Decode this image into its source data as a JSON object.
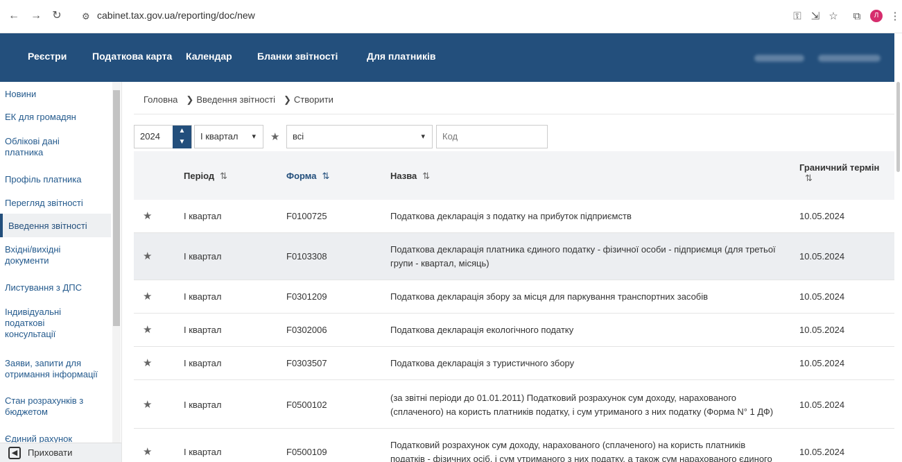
{
  "browser": {
    "url": "cabinet.tax.gov.ua/reporting/doc/new",
    "profile_initial": "Л"
  },
  "topnav": {
    "items": [
      "Реєстри",
      "Податкова карта",
      "Календар",
      "Бланки звітності",
      "Для платників"
    ]
  },
  "sidebar": {
    "items": [
      "Новини",
      "ЕК для громадян",
      "Облікові дані платника",
      "Профіль платника",
      "Перегляд звітності",
      "Введення звітності",
      "Вхідні/вихідні документи",
      "Листування з ДПС",
      "Індивідуальні податкові консультації",
      "Заяви, запити для отримання інформації",
      "Стан розрахунків з бюджетом",
      "Єдиний рахунок"
    ],
    "hide_label": "Приховати"
  },
  "breadcrumb": [
    "Головна",
    "Введення звітності",
    "Створити"
  ],
  "filters": {
    "year": "2024",
    "period": "І квартал",
    "category": "всі",
    "code_placeholder": "Код"
  },
  "table": {
    "headers": {
      "period": "Період",
      "form": "Форма",
      "name": "Назва",
      "deadline_1": "Граничний термін"
    },
    "rows": [
      {
        "period": "І квартал",
        "form": "F0100725",
        "name": "Податкова декларація з податку на прибуток підприємств",
        "deadline": "10.05.2024"
      },
      {
        "period": "І квартал",
        "form": "F0103308",
        "name": "Податкова декларація платника єдиного податку - фізичної особи - підприємця (для третьої групи - квартал, місяць)",
        "deadline": "10.05.2024"
      },
      {
        "period": "І квартал",
        "form": "F0301209",
        "name": "Податкова декларація збору за місця для паркування транспортних засобів",
        "deadline": "10.05.2024"
      },
      {
        "period": "І квартал",
        "form": "F0302006",
        "name": "Податкова декларація екологічного податку",
        "deadline": "10.05.2024"
      },
      {
        "period": "І квартал",
        "form": "F0303507",
        "name": "Податкова декларація з туристичного збору",
        "deadline": "10.05.2024"
      },
      {
        "period": "І квартал",
        "form": "F0500102",
        "name": "(за звітні періоди до 01.01.2011) Податковий розрахунок сум доходу, нарахованого (сплаченого) на користь платників податку, і сум утриманого з них податку (Форма N° 1 ДФ)",
        "deadline": "10.05.2024"
      },
      {
        "period": "І квартал",
        "form": "F0500109",
        "name": "Податковий розрахунок сум доходу, нарахованого (сплаченого) на користь платників податків - фізичних осіб, і сум утриманого з них податку, а також сум нарахованого єдиного внеску",
        "deadline": "10.05.2024"
      }
    ]
  }
}
